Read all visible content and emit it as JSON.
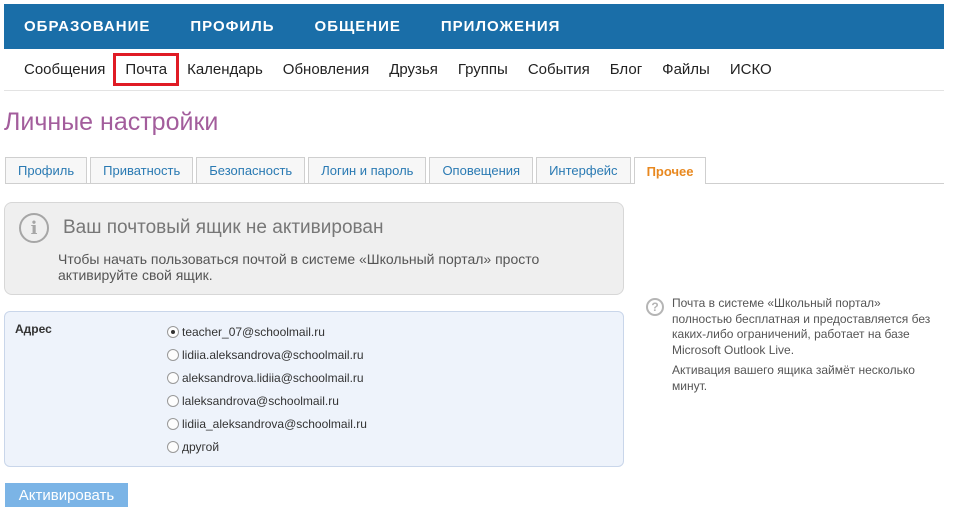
{
  "topnav": {
    "items": [
      "ОБРАЗОВАНИЕ",
      "ПРОФИЛЬ",
      "ОБЩЕНИЕ",
      "ПРИЛОЖЕНИЯ"
    ]
  },
  "subnav": {
    "items": [
      "Сообщения",
      "Почта",
      "Календарь",
      "Обновления",
      "Друзья",
      "Группы",
      "События",
      "Блог",
      "Файлы",
      "ИСКО"
    ],
    "highlighted": "Почта"
  },
  "page": {
    "title": "Личные настройки"
  },
  "tabs": {
    "items": [
      "Профиль",
      "Приватность",
      "Безопасность",
      "Логин и пароль",
      "Оповещения",
      "Интерфейс",
      "Прочее"
    ],
    "active": "Прочее"
  },
  "alert": {
    "title": "Ваш почтовый ящик не активирован",
    "text": "Чтобы начать пользоваться почтой в системе «Школьный портал» просто активируйте свой ящик."
  },
  "form": {
    "label": "Адрес",
    "options": [
      "teacher_07@schoolmail.ru",
      "lidiia.aleksandrova@schoolmail.ru",
      "aleksandrova.lidiia@schoolmail.ru",
      "laleksandrova@schoolmail.ru",
      "lidiia_aleksandrova@schoolmail.ru",
      "другой"
    ],
    "selected": "teacher_07@schoolmail.ru"
  },
  "activate_button": "Активировать",
  "side_help": {
    "text1": "Почта в системе «Школьный портал» полностью бесплатная и предоставляется без каких-либо ограничений, работает на базе Microsoft Outlook Live.",
    "text2": "Активация вашего ящика займёт несколько минут."
  },
  "colors": {
    "topnav_bg": "#1a6ea8",
    "title": "#a35d9c",
    "active_tab": "#e8881f",
    "highlight": "#e01b24",
    "button": "#7bb4e6"
  },
  "icons": {
    "alert": "info-icon",
    "side_help": "question-icon"
  }
}
